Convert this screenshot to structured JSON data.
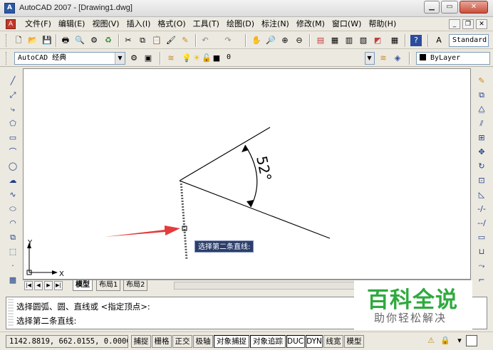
{
  "window": {
    "title": "AutoCAD 2007 - [Drawing1.dwg]",
    "icon": "autocad-logo-icon",
    "controls": [
      "minimize",
      "maximize",
      "close"
    ]
  },
  "menu": {
    "items": [
      "文件(F)",
      "编辑(E)",
      "视图(V)",
      "插入(I)",
      "格式(O)",
      "工具(T)",
      "绘图(D)",
      "标注(N)",
      "修改(M)",
      "窗口(W)",
      "帮助(H)"
    ]
  },
  "toolbar_standard": {
    "text_style": "Standard"
  },
  "toolbar_workspace": {
    "workspace": "AutoCAD 经典",
    "layer": "0",
    "color": "ByLayer"
  },
  "drawing": {
    "dimension_text": "52°",
    "tooltip": "选择第二条直线:",
    "ucs_x": "X",
    "ucs_y": "Y",
    "arrow_color": "#e53b3b"
  },
  "tabs": {
    "items": [
      "模型",
      "布局1",
      "布局2"
    ],
    "active": "模型"
  },
  "command_line": {
    "line1": "选择圆弧、圆、直线或 <指定顶点>:",
    "line2": "选择第二条直线:"
  },
  "status_bar": {
    "coords": "1142.8819, 662.0155, 0.0000",
    "buttons": [
      "捕捉",
      "栅格",
      "正交",
      "极轴",
      "对象捕捉",
      "对象追踪",
      "DUCS",
      "DYN",
      "线宽",
      "模型"
    ]
  },
  "watermark": {
    "title": "百科全说",
    "subtitle": "助你轻松解决",
    "color": "#2faa3f"
  }
}
